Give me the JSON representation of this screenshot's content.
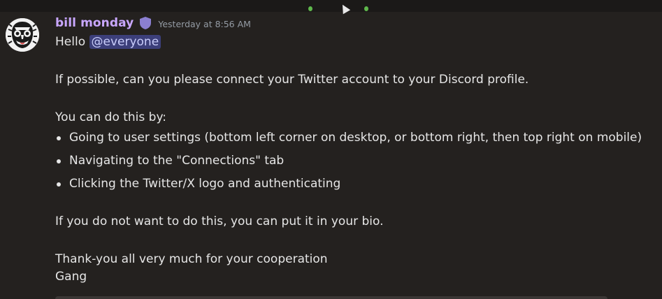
{
  "message": {
    "username": "bill monday",
    "badge_icon": "shield-badge-icon",
    "timestamp": "Yesterday at 8:56 AM",
    "greeting": "Hello",
    "mention": "@everyone",
    "paragraph1": "If possible, can you please connect your Twitter account to your Discord profile.",
    "intro": "You can do this by:",
    "steps": [
      "Going to user settings (bottom left corner on desktop, or bottom right, then top right on mobile)",
      "Navigating to the \"Connections\" tab",
      "Clicking the Twitter/X logo and authenticating"
    ],
    "paragraph2": "If you do not want to do this, you can put it in your bio.",
    "closing": "Thank-you all very much for your cooperation",
    "signoff": "Gang"
  },
  "colors": {
    "background": "#24211f",
    "username": "#c9a7ff",
    "timestamp": "#949ba4",
    "text": "#e6e6e6",
    "mention_bg": "#3c3f7a",
    "mention_text": "#c9cdfb",
    "badge": "#8b7fd1"
  }
}
